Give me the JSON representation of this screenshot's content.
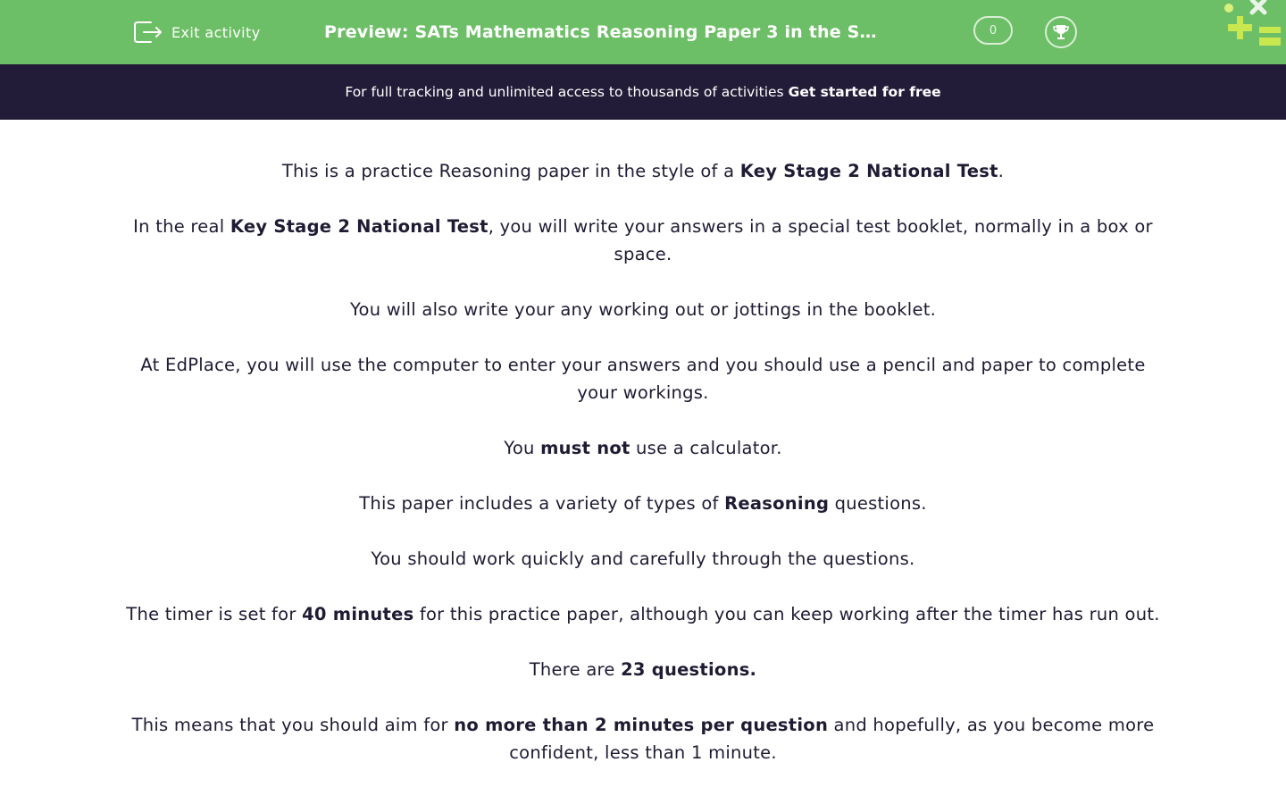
{
  "header": {
    "exit_label": "Exit activity",
    "title": "Preview: SATs Mathematics Reasoning Paper 3 in the Style…",
    "score": "0",
    "colors": {
      "bar": "#6dbf67",
      "promo": "#231c38",
      "text": "#1e1b33"
    },
    "icons": [
      "exit-icon",
      "trophy-icon",
      "edplace-logo-icon"
    ]
  },
  "promo": {
    "text": "For full tracking and unlimited access to thousands of activities",
    "cta": "Get started for free"
  },
  "paragraphs": {
    "p1": {
      "a": "This is a practice Reasoning paper in the style of a ",
      "b": "Key Stage 2 National Test",
      "c": "."
    },
    "p2": {
      "a": "In the real ",
      "b": "Key Stage 2 National Test",
      "c": ", you will write your answers in a special test booklet, normally in a box or space."
    },
    "p3": {
      "a": "You will also write your any working out or jottings in the booklet."
    },
    "p4": {
      "a": "At EdPlace, you will use the computer to enter your answers and you should use a pencil and paper to complete your workings."
    },
    "p5": {
      "a": "You ",
      "b": "must not",
      "c": " use a calculator."
    },
    "p6": {
      "a": "This paper includes a variety of types of ",
      "b": "Reasoning",
      "c": " questions."
    },
    "p7": {
      "a": "You should work quickly and carefully through the questions."
    },
    "p8": {
      "a": "The timer is set for ",
      "b": "40 minutes",
      "c": " for this practice paper, although you can keep working after the timer has run out."
    },
    "p9": {
      "a": "There are ",
      "b": "23 questions."
    },
    "p10": {
      "a": "This means that you should aim for ",
      "b": "no more than 2 minutes per question",
      "c": " and hopefully, as you become more confident, less than 1 minute."
    }
  }
}
